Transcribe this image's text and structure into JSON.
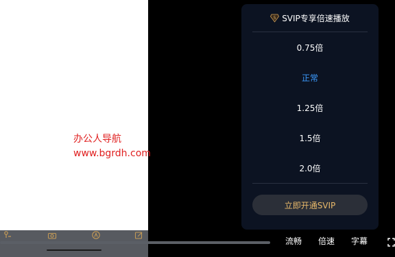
{
  "watermark": {
    "line1": "办公人导航",
    "line2": "www.bgrdh.com"
  },
  "speed_panel": {
    "header_badge": "5",
    "header_title": "SVIP专享倍速播放",
    "options": [
      {
        "label": "0.75倍",
        "active": false
      },
      {
        "label": "正常",
        "active": true
      },
      {
        "label": "1.25倍",
        "active": false
      },
      {
        "label": "1.5倍",
        "active": false
      },
      {
        "label": "2.0倍",
        "active": false
      }
    ],
    "cta_label": "立即开通SVIP"
  },
  "controls": {
    "quality": "流畅",
    "speed": "倍速",
    "subtitles": "字幕"
  },
  "colors": {
    "active_speed": "#3b9bff",
    "cta_text": "#e8b96a",
    "watermark": "#e02020",
    "panel_bg": "#0c1322"
  },
  "icons": {
    "badge": "svip-level-badge-icon",
    "fullscreen": "fullscreen-icon"
  }
}
